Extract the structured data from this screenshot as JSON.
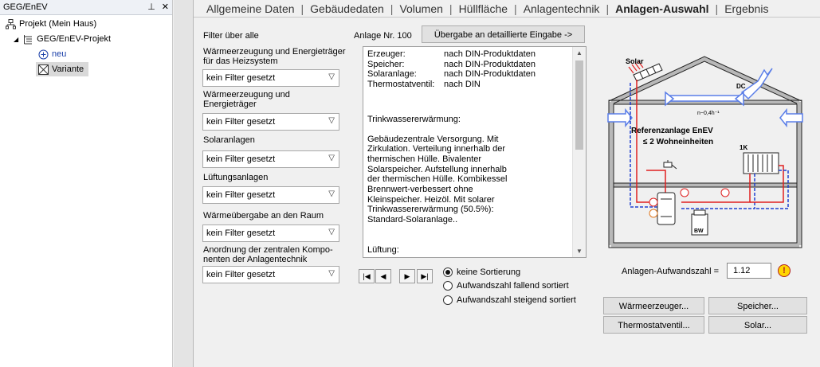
{
  "tree": {
    "title": "GEG/EnEV",
    "pin_glyph": "⊥",
    "close_glyph": "✕",
    "items": [
      {
        "label": "Projekt (Mein Haus)"
      },
      {
        "label": "GEG/EnEV-Projekt"
      },
      {
        "label": "neu"
      },
      {
        "label": "Variante"
      }
    ]
  },
  "tabs": [
    "Allgemeine Daten",
    "Gebäudedaten",
    "Volumen",
    "Hüllfläche",
    "Anlagentechnik",
    "Anlagen-Auswahl",
    "Ergebnis"
  ],
  "active_tab": "Anlagen-Auswahl",
  "filter": {
    "title": "Filter über alle",
    "groups": [
      {
        "label_lines": [
          "Wärmeerzeugung und Energieträger",
          "für das Heizsystem"
        ],
        "value": "kein Filter gesetzt"
      },
      {
        "label_lines": [
          "Wärmeerzeugung und",
          "Energieträger"
        ],
        "value": "kein Filter gesetzt"
      },
      {
        "label_lines": [
          "Solaranlagen"
        ],
        "value": "kein Filter gesetzt"
      },
      {
        "label_lines": [
          "Lüftungsanlagen"
        ],
        "value": "kein Filter gesetzt"
      },
      {
        "label_lines": [
          "Wärmeübergabe an den Raum"
        ],
        "value": "kein Filter gesetzt"
      },
      {
        "label_lines": [
          "Anordnung der zentralen Kompo-",
          "nenten der Anlagentechnik"
        ],
        "value": "kein Filter gesetzt"
      }
    ]
  },
  "anlage": {
    "label": "Anlage Nr. 100",
    "transfer_button": "Übergabe an detaillierte Eingabe ->",
    "specs": [
      {
        "key": "Erzeuger:",
        "value": "nach DIN-Produktdaten"
      },
      {
        "key": "Speicher:",
        "value": "nach DIN-Produktdaten"
      },
      {
        "key": "Solaranlage:",
        "value": "nach DIN-Produktdaten"
      },
      {
        "key": "Thermostatventil:",
        "value": "nach DIN"
      }
    ],
    "trinkwasser_heading": "Trinkwassererwärmung:",
    "description_lines": [
      "Gebäudezentrale Versorgung. Mit",
      "Zirkulation. Verteilung innerhalb der",
      "thermischen Hülle. Bivalenter",
      "Solarspeicher. Aufstellung innerhalb",
      "der thermischen Hülle. Kombikessel",
      "Brennwert-verbessert ohne",
      "Kleinspeicher. Heizöl. Mit solarer",
      "Trinkwassererwärmung (50.5%):",
      "Standard-Solaranlage.."
    ],
    "lueftung_heading": "Lüftung:"
  },
  "nav": {
    "first": "|◀",
    "prev": "◀",
    "next": "▶",
    "last": "▶|"
  },
  "sort": {
    "options": [
      "keine Sortierung",
      "Aufwandszahl fallend sortiert",
      "Aufwandszahl steigend sortiert"
    ],
    "selected_index": 0
  },
  "diagram": {
    "solar_label": "Solar",
    "dc_label": "DC",
    "n_label": "n~0,4h⁻¹",
    "title": "Referenzanlage EnEV",
    "subtitle": "≤ 2 Wohneinheiten",
    "radiator_label": "1K",
    "boiler_label": "BW",
    "colors": {
      "supply": "#e02020",
      "return": "#1f3fd0",
      "wall": "#b8b8b8",
      "vent": "#5a7ee8"
    }
  },
  "result": {
    "label": "Anlagen-Aufwandszahl =",
    "value": "1.12",
    "warning_glyph": "!"
  },
  "buttons": {
    "waermeerzeuger": "Wärmeerzeuger...",
    "speicher": "Speicher...",
    "thermostatventil": "Thermostatventil...",
    "solar": "Solar..."
  }
}
